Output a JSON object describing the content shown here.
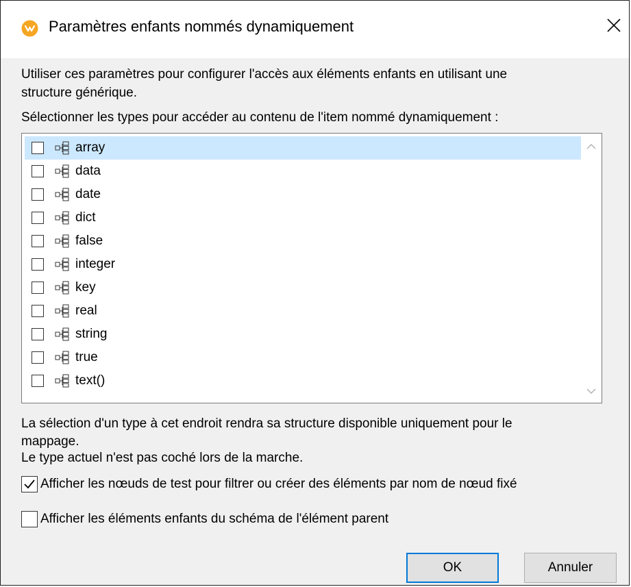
{
  "window": {
    "title": "Paramètres enfants nommés dynamiquement"
  },
  "intro": {
    "line1": "Utiliser ces paramètres pour configurer l'accès aux éléments enfants en utilisant une",
    "line2": "structure générique.",
    "select_label": "Sélectionner les types pour accéder au contenu de l'item nommé dynamiquement :"
  },
  "types": [
    {
      "label": "array",
      "checked": false,
      "selected": true
    },
    {
      "label": "data",
      "checked": false,
      "selected": false
    },
    {
      "label": "date",
      "checked": false,
      "selected": false
    },
    {
      "label": "dict",
      "checked": false,
      "selected": false
    },
    {
      "label": "false",
      "checked": false,
      "selected": false
    },
    {
      "label": "integer",
      "checked": false,
      "selected": false
    },
    {
      "label": "key",
      "checked": false,
      "selected": false
    },
    {
      "label": "real",
      "checked": false,
      "selected": false
    },
    {
      "label": "string",
      "checked": false,
      "selected": false
    },
    {
      "label": "true",
      "checked": false,
      "selected": false
    },
    {
      "label": "text()",
      "checked": false,
      "selected": false
    }
  ],
  "notes": {
    "line1": "La sélection d'un type à cet endroit rendra sa structure disponible uniquement pour le",
    "line2": "mappage.",
    "line3": "Le type actuel n'est pas coché lors de la marche."
  },
  "options": {
    "show_test_nodes": {
      "label": "Afficher les nœuds de test pour filtrer ou créer des éléments par nom de nœud fixé",
      "checked": true
    },
    "show_schema_children": {
      "label": "Afficher les éléments enfants du schéma de l'élément parent",
      "checked": false
    }
  },
  "buttons": {
    "ok": "OK",
    "cancel": "Annuler"
  },
  "colors": {
    "selection": "#cce8ff",
    "default_button_border": "#0078d7",
    "app_icon": "#f5a623"
  },
  "icons": {
    "app": "mapforce-app-icon",
    "close": "close-icon",
    "tree": "tree-node-icon",
    "scroll_up": "chevron-up-icon",
    "scroll_down": "chevron-down-icon",
    "check": "checkmark-icon"
  }
}
